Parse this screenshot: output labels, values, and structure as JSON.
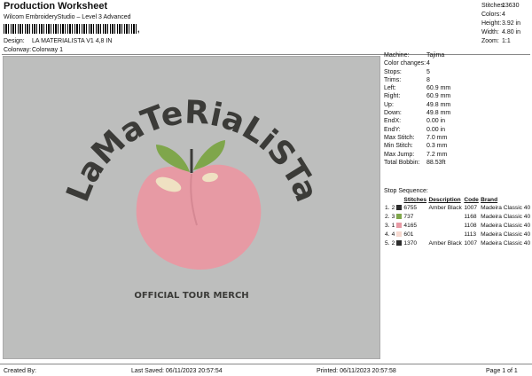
{
  "header": {
    "title": "Production Worksheet",
    "subtitle": "Wilcom EmbroideryStudio – Level 3 Advanced",
    "barcode_suffix": ","
  },
  "stats": [
    {
      "label": "Stitches:",
      "value": "13630"
    },
    {
      "label": "Colors:",
      "value": "4"
    },
    {
      "label": "Height:",
      "value": "3.92 in"
    },
    {
      "label": "Width:",
      "value": "4.80 in"
    },
    {
      "label": "Zoom:",
      "value": "1:1"
    }
  ],
  "meta": [
    {
      "label": "Design:",
      "value": "LA MATERIALISTA V1 4,8 IN"
    },
    {
      "label": "Colorway:",
      "value": "Colorway 1"
    }
  ],
  "design": {
    "arc_text": "LaMaTeRiaLiSTa",
    "tagline": "OFFICIAL TOUR MERCH",
    "colors": {
      "background": "#bdbebd",
      "text": "#3b3b38",
      "peach": "#e79aa4",
      "leaf": "#7fa64b",
      "highlight": "#efe1c2"
    }
  },
  "properties": [
    {
      "label": "Machine:",
      "value": "Tajima"
    },
    {
      "label": "Color changes:",
      "value": "4"
    },
    {
      "label": "Stops:",
      "value": "5"
    },
    {
      "label": "Trims:",
      "value": "8"
    },
    {
      "label": "Left:",
      "value": "60.9 mm"
    },
    {
      "label": "Right:",
      "value": "60.9 mm"
    },
    {
      "label": "Up:",
      "value": "49.8 mm"
    },
    {
      "label": "Down:",
      "value": "49.8 mm"
    },
    {
      "label": "EndX:",
      "value": "0.00 in"
    },
    {
      "label": "EndY:",
      "value": "0.00 in"
    },
    {
      "label": "Max Stitch:",
      "value": "7.0 mm"
    },
    {
      "label": "Min Stitch:",
      "value": "0.3 mm"
    },
    {
      "label": "Max Jump:",
      "value": "7.2 mm"
    },
    {
      "label": "Total Bobbin:",
      "value": "88.53ft"
    }
  ],
  "sequence": {
    "title": "Stop Sequence:",
    "headers": [
      "",
      "",
      "",
      "Stitches",
      "Description",
      "Code",
      "Brand"
    ],
    "rows": [
      {
        "stop": "1.",
        "n": "2",
        "color": "#2b2b2b",
        "stitches": "6755",
        "desc": "Amber Black",
        "code": "1007",
        "brand": "Madeira Classic 40"
      },
      {
        "stop": "2.",
        "n": "3",
        "color": "#7fa64b",
        "stitches": "737",
        "desc": "",
        "code": "1168",
        "brand": "Madeira Classic 40"
      },
      {
        "stop": "3.",
        "n": "1",
        "color": "#e79aa4",
        "stitches": "4165",
        "desc": "",
        "code": "1108",
        "brand": "Madeira Classic 40"
      },
      {
        "stop": "4.",
        "n": "4",
        "color": "#f6d9d0",
        "stitches": "601",
        "desc": "",
        "code": "1113",
        "brand": "Madeira Classic 40"
      },
      {
        "stop": "5.",
        "n": "2",
        "color": "#2b2b2b",
        "stitches": "1370",
        "desc": "Amber Black",
        "code": "1007",
        "brand": "Madeira Classic 40"
      }
    ]
  },
  "footer": {
    "created": "Created By:",
    "saved": "Last Saved: 06/11/2023 20:57:54",
    "printed": "Printed: 06/11/2023 20:57:58",
    "page": "Page 1 of 1"
  }
}
